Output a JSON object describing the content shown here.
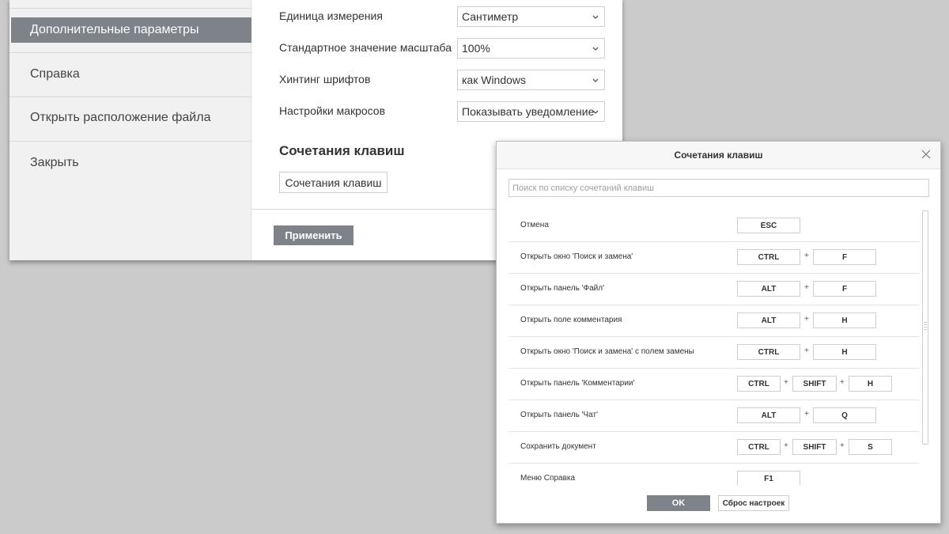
{
  "sidebar": {
    "items": [
      {
        "label": "Дополнительные параметры",
        "active": true
      },
      {
        "label": "Справка"
      },
      {
        "label": "Открыть расположение файла"
      },
      {
        "label": "Закрыть"
      }
    ]
  },
  "settings": {
    "rows": [
      {
        "label": "Единица измерения",
        "value": "Сантиметр"
      },
      {
        "label": "Стандартное значение масштаба",
        "value": "100%"
      },
      {
        "label": "Хинтинг шрифтов",
        "value": "как Windows"
      },
      {
        "label": "Настройки макросов",
        "value": "Показывать уведомление"
      }
    ],
    "section_title": "Сочетания клавиш",
    "shortcuts_button": "Сочетания клавиш",
    "apply_button": "Применить"
  },
  "dialog": {
    "title": "Сочетания клавиш",
    "search_placeholder": "Поиск по списку сочетаний клавиш",
    "shortcuts": [
      {
        "label": "Отмена",
        "keys": [
          "ESC"
        ]
      },
      {
        "label": "Открыть окно 'Поиск и замена'",
        "keys": [
          "CTRL",
          "F"
        ]
      },
      {
        "label": "Открыть панель 'Файл'",
        "keys": [
          "ALT",
          "F"
        ]
      },
      {
        "label": "Открыть поле комментария",
        "keys": [
          "ALT",
          "H"
        ]
      },
      {
        "label": "Открыть окно 'Поиск и замена' с полем замены",
        "keys": [
          "CTRL",
          "H"
        ]
      },
      {
        "label": "Открыть панель 'Комментарии'",
        "keys": [
          "CTRL",
          "SHIFT",
          "H"
        ]
      },
      {
        "label": "Открыть панель 'Чат'",
        "keys": [
          "ALT",
          "Q"
        ]
      },
      {
        "label": "Сохранить документ",
        "keys": [
          "CTRL",
          "SHIFT",
          "S"
        ]
      },
      {
        "label": "Меню Справка",
        "keys": [
          "F1"
        ]
      }
    ],
    "plus_sign": "+",
    "ok_button": "OK",
    "reset_button": "Сброс настроек"
  },
  "colors": {
    "accent": "#7e838a",
    "background": "#cbcbcb"
  }
}
